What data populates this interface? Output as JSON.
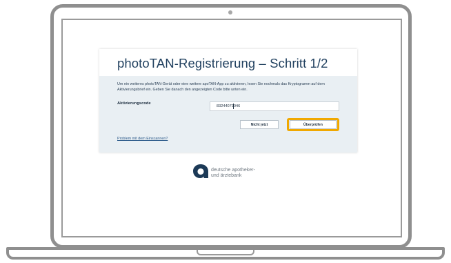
{
  "dialog": {
    "title": "photoTAN-Registrierung – Schritt 1/2",
    "description": "Um ein weiteres photoTAN-Gerät oder eine weitere apoTAN-App zu aktivieren, lesen Sie nochmals das Kryptogramm auf dem Aktivierungsbrief ein. Geben Sie danach den angezeigten Code bitte unten ein.",
    "field_label": "Aktivierungscode",
    "code_value": "83244079046",
    "later_button": "Nicht jetzt",
    "check_button": "Überprüfen",
    "scan_problem_link": "Problem mit dem Einscannen?"
  },
  "logo": {
    "line1": "deutsche apotheker-",
    "line2": "und ärztebank",
    "icon": "apobank-logo-mark"
  },
  "colors": {
    "title": "#1f3f5e",
    "body_bg": "#e9eff3",
    "highlight": "#f0a800",
    "link": "#2c5a8a",
    "logo_mark": "#1c3a57",
    "device_frame": "#8f8f8f"
  }
}
